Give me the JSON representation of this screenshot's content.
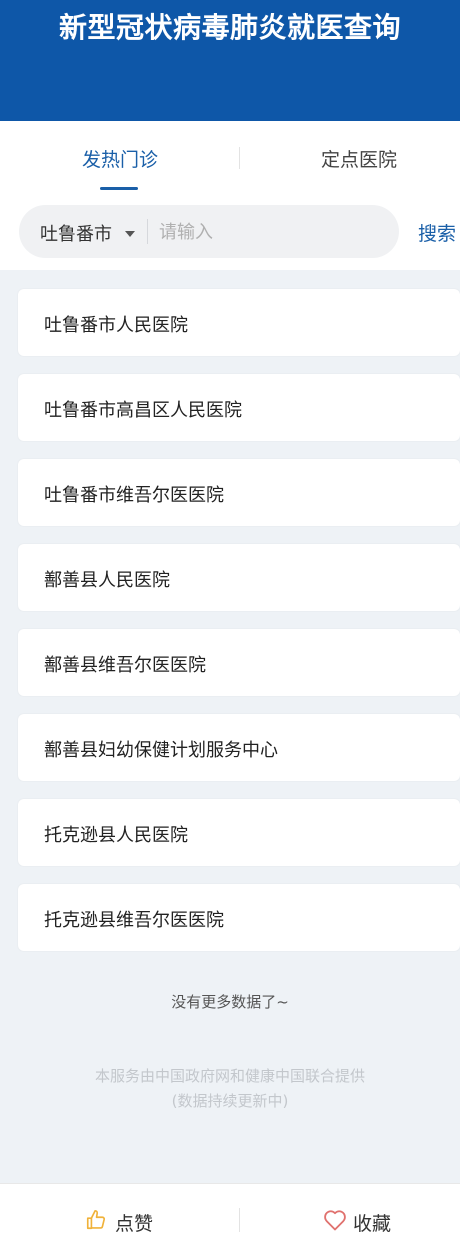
{
  "header": {
    "title": "新型冠状病毒肺炎就医查询"
  },
  "tabs": [
    {
      "label": "发热门诊",
      "active": true
    },
    {
      "label": "定点医院",
      "active": false
    }
  ],
  "search": {
    "city": "吐鲁番市",
    "placeholder": "请输入",
    "value": "",
    "button_label": "搜索"
  },
  "hospitals": [
    "吐鲁番市人民医院",
    "吐鲁番市高昌区人民医院",
    "吐鲁番市维吾尔医医院",
    "鄯善县人民医院",
    "鄯善县维吾尔医医院",
    "鄯善县妇幼保健计划服务中心",
    "托克逊县人民医院",
    "托克逊县维吾尔医医院"
  ],
  "status": {
    "no_more": "没有更多数据了~",
    "footnote_line1": "本服务由中国政府网和健康中国联合提供",
    "footnote_line2": "(数据持续更新中)"
  },
  "bottom_bar": {
    "like_label": "点赞",
    "favorite_label": "收藏"
  },
  "colors": {
    "header_bg": "#0e57a8",
    "accent": "#1a5fa8",
    "like_icon": "#f0b23a",
    "favorite_icon": "#e0716e"
  },
  "icons": {
    "like": "thumbs-up-icon",
    "favorite": "heart-icon",
    "dropdown": "caret-down-icon"
  }
}
